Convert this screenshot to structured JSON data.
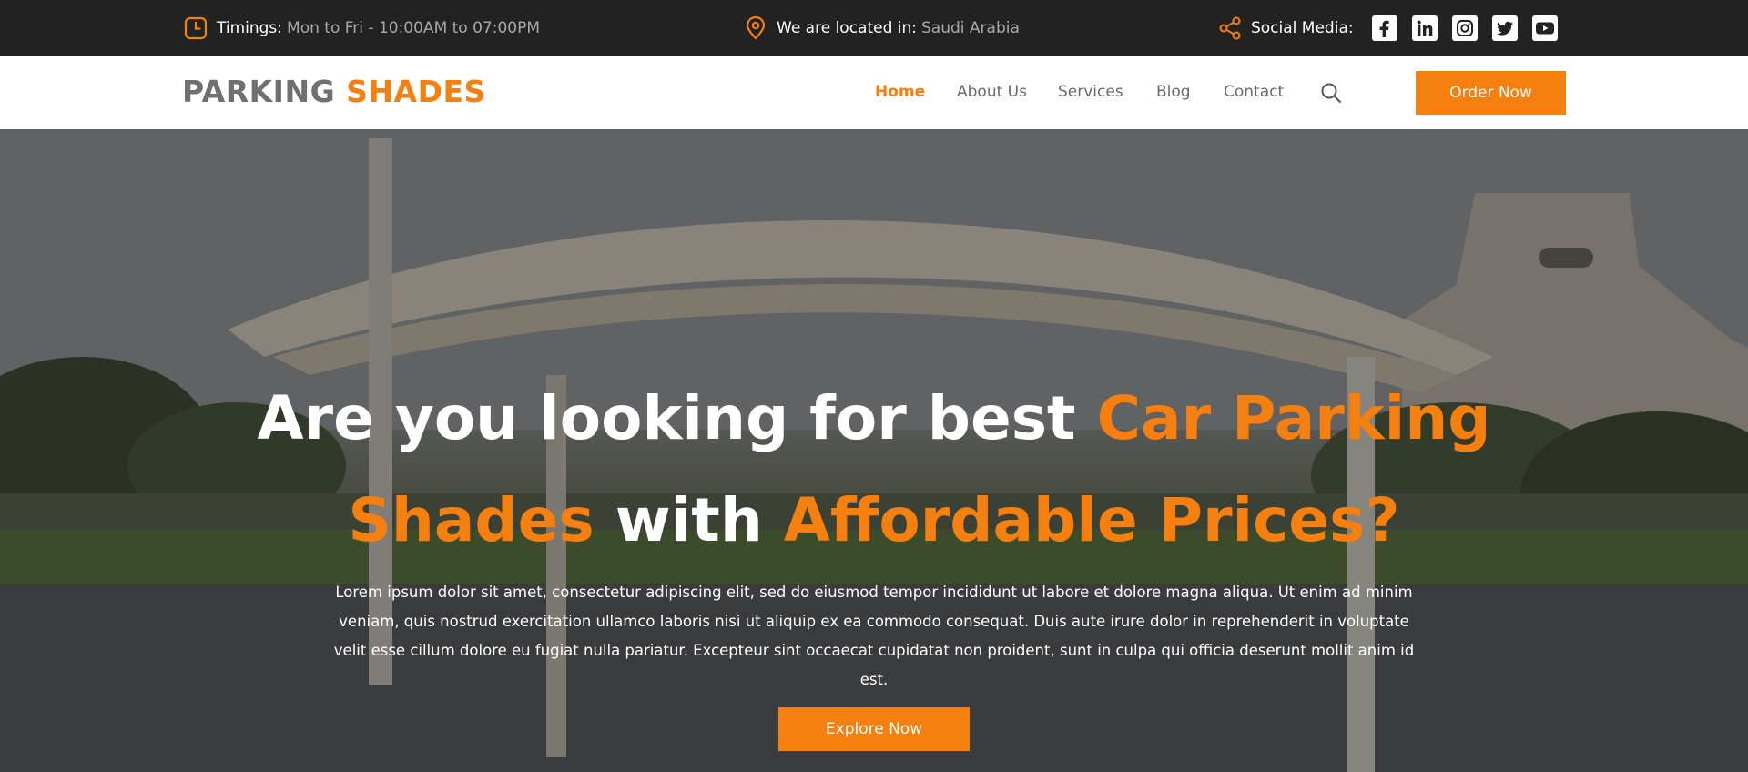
{
  "topbar": {
    "timings_label": "Timings:",
    "timings_value": "Mon to Fri - 10:00AM to 07:00PM",
    "location_label": "We are located in:",
    "location_value": "Saudi Arabia",
    "social_label": "Social Media:",
    "social_icons": [
      "facebook-icon",
      "linkedin-icon",
      "instagram-icon",
      "twitter-icon",
      "youtube-icon"
    ]
  },
  "header": {
    "logo_part1": "PARKING",
    "logo_part2": "SHADES",
    "nav": [
      {
        "label": "Home",
        "active": true
      },
      {
        "label": "About Us"
      },
      {
        "label": "Services"
      },
      {
        "label": "Blog"
      },
      {
        "label": "Contact"
      }
    ],
    "order_label": "Order Now"
  },
  "hero": {
    "title_1": "Are you looking for best ",
    "title_2": "Car Parking",
    "title_3": "Shades",
    "title_4": " with ",
    "title_5": "Affordable Prices?",
    "text": "Lorem ipsum dolor sit amet, consectetur adipiscing elit, sed do eiusmod tempor incididunt ut labore et dolore magna aliqua. Ut enim ad minim veniam, quis nostrud exercitation ullamco laboris nisi ut aliquip ex ea commodo consequat. Duis aute irure dolor in reprehenderit in voluptate velit esse cillum dolore eu fugiat nulla pariatur. Excepteur sint occaecat cupidatat non proident, sunt in culpa qui officia deserunt mollit anim id est.",
    "cta_label": "Explore Now"
  },
  "colors": {
    "accent": "#f57f0f",
    "topbar_bg": "#222222",
    "header_bg": "#ffffff"
  }
}
